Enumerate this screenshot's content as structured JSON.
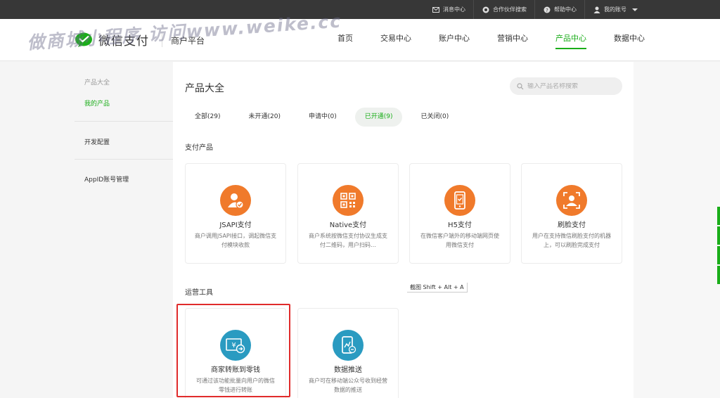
{
  "topbar": {
    "links": [
      {
        "label": "消息中心",
        "icon": "mail-icon"
      },
      {
        "label": "合作伙伴搜索",
        "icon": "partner-icon"
      },
      {
        "label": "帮助中心",
        "icon": "help-icon"
      },
      {
        "label": "我的账号",
        "icon": "user-icon"
      }
    ]
  },
  "header": {
    "logo_text": "微信支付",
    "platform": "商户平台",
    "nav": [
      "首页",
      "交易中心",
      "账户中心",
      "营销中心",
      "产品中心",
      "数据中心"
    ],
    "active_nav": "产品中心"
  },
  "watermark": "做商城小程序 访问www.weike.cc",
  "sidebar": {
    "group_label": "产品大全",
    "items": [
      "我的产品",
      "开发配置",
      "AppID账号管理"
    ]
  },
  "main": {
    "title": "产品大全",
    "search_placeholder": "输入产品名称搜索",
    "tabs": [
      "全部(29)",
      "未开通(20)",
      "申请中(0)",
      "已开通(9)",
      "已关闭(0)"
    ],
    "active_tab": "已开通(9)",
    "sections": [
      {
        "title": "支付产品",
        "cards": [
          {
            "title": "JSAPI支付",
            "desc": "商户调用JSAPI接口，调起微信支付模块收款",
            "icon": "jsapi-pay-icon",
            "color": "#f07a2b"
          },
          {
            "title": "Native支付",
            "desc": "商户系统按微信支付协议生成支付二维码，用户扫码…",
            "icon": "qrcode-icon",
            "color": "#f07a2b"
          },
          {
            "title": "H5支付",
            "desc": "在微信客户端外的移动端网页使用微信支付",
            "icon": "mobile-pay-icon",
            "color": "#f07a2b"
          },
          {
            "title": "刷脸支付",
            "desc": "用户在支持微信刷脸支付的机器上，可以刷脸完成支付",
            "icon": "face-pay-icon",
            "color": "#f07a2b"
          }
        ]
      },
      {
        "title": "运营工具",
        "cards": [
          {
            "title": "商家转账到零钱",
            "desc": "可通过该功能批量向用户的微信零钱进行转账",
            "icon": "transfer-icon",
            "color": "#2a9bc1"
          },
          {
            "title": "数据推送",
            "desc": "商户可在移动端公众号收到经营数据的推送",
            "icon": "data-push-icon",
            "color": "#2a9bc1"
          }
        ]
      }
    ],
    "screenshot_hint": "截图 Shift + Alt + A"
  },
  "colors": {
    "accent": "#1aad19",
    "orange": "#f07a2b",
    "blue": "#2a9bc1",
    "highlight": "#e02b2b"
  }
}
